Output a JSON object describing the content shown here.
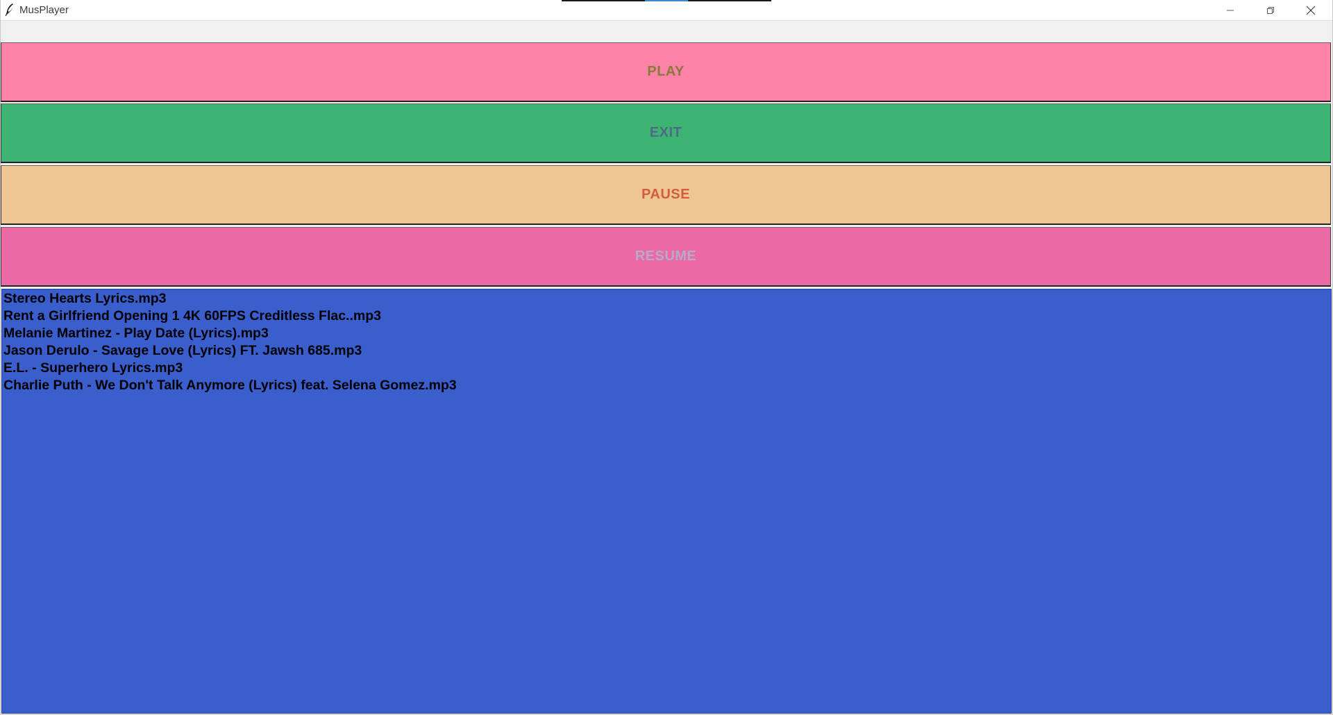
{
  "window": {
    "title": "MusPlayer",
    "icon": "feather-icon"
  },
  "title_controls": {
    "minimize_icon": "minimize-icon",
    "maximize_icon": "restore-icon",
    "close_icon": "close-icon"
  },
  "buttons": [
    {
      "label": "PLAY",
      "bg": "#ff82a9",
      "fg": "#8a7a3a"
    },
    {
      "label": "EXIT",
      "bg": "#3db371",
      "fg": "#4d6a8a"
    },
    {
      "label": "PAUSE",
      "bg": "#efc592",
      "fg": "#d35d3d"
    },
    {
      "label": "RESUME",
      "bg": "#eb69a5",
      "fg": "#b8a9c9"
    }
  ],
  "playlist": {
    "bg": "#3a5fcd",
    "items": [
      "Stereo Hearts Lyrics.mp3",
      "Rent a Girlfriend Opening 1 4K 60FPS Creditless Flac..mp3",
      "Melanie Martinez - Play Date (Lyrics).mp3",
      "Jason Derulo - Savage Love (Lyrics) FT. Jawsh 685.mp3",
      "E.L. - Superhero Lyrics.mp3",
      "Charlie Puth - We Don't Talk Anymore (Lyrics) feat. Selena Gomez.mp3"
    ]
  }
}
